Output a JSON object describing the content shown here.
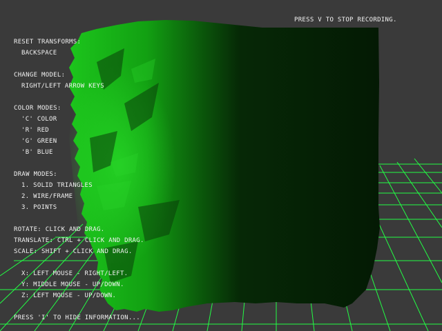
{
  "recording": "PRESS V TO STOP RECORDING.",
  "info": {
    "reset_title": "RESET TRANSFORMS:",
    "reset_key": "BACKSPACE",
    "model_title": "CHANGE MODEL:",
    "model_key": "RIGHT/LEFT ARROW KEYS",
    "color_title": "COLOR MODES:",
    "color_modes": [
      "'C' COLOR",
      "'R' RED",
      "'G' GREEN",
      "'B' BLUE"
    ],
    "draw_title": "DRAW MODES:",
    "draw_modes": [
      "1. SOLID TRIANGLES",
      "2. WIRE/FRAME",
      "3. POINTS"
    ],
    "rotate": "ROTATE: CLICK AND DRAG.",
    "translate": "TRANSLATE: CTRL + CLICK AND DRAG.",
    "scale": "SCALE: SHIFT + CLICK AND DRAG.",
    "axes": [
      "X: LEFT MOUSE - RIGHT/LEFT.",
      "Y: MIDDLE MOUSE - UP/DOWN.",
      "Z: LEFT MOUSE - UP/DOWN."
    ],
    "hide": "PRESS 'I' TO HIDE INFORMATION..."
  },
  "colors": {
    "background": "#3a3a3a",
    "grid": "#22ff44",
    "terrain": "#1fbf1f",
    "text": "#f2f2f2"
  }
}
